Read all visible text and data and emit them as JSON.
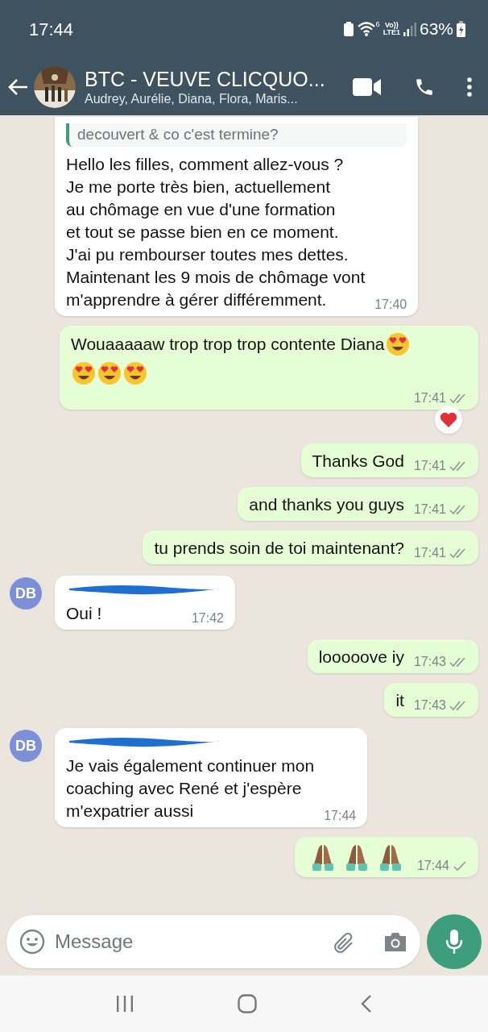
{
  "status_bar": {
    "time": "17:44",
    "network_label_top": "Vo))",
    "network_label_bottom": "LTE1",
    "wifi_superscript": "6",
    "battery": "63%"
  },
  "header": {
    "title": "BTC - VEUVE CLICQUO...",
    "subtitle": "Audrey, Aurélie, Diana, Flora, Maris..."
  },
  "messages": [
    {
      "kind": "incoming",
      "quote": "decouvert & co c'est termine?",
      "parts": [
        {
          "kind": "text",
          "text": "Hello les filles, comment allez-vous ?\nJe me porte très bien, actuellement\nau chômage en vue d'une formation\net tout se passe bien en ce moment.\nJ'ai pu rembourser toutes mes dettes.\nMaintenant les 9 mois de chômage vont\nm'apprendre à gérer différemment."
        }
      ],
      "time": "17:40"
    },
    {
      "kind": "outgoing",
      "parts": [
        {
          "kind": "text",
          "text": "Wouaaaaaw trop trop trop contente Diana"
        },
        {
          "kind": "heart_eyes"
        },
        {
          "kind": "break"
        },
        {
          "kind": "heart_eyes"
        },
        {
          "kind": "heart_eyes"
        },
        {
          "kind": "heart_eyes"
        }
      ],
      "time": "17:41",
      "double_tick": true,
      "heart_reaction": true
    },
    {
      "kind": "outgoing",
      "parts": [
        {
          "kind": "text",
          "text": "Thanks God"
        }
      ],
      "time": "17:41",
      "double_tick": true
    },
    {
      "kind": "outgoing",
      "parts": [
        {
          "kind": "text",
          "text": "and thanks you guys"
        }
      ],
      "time": "17:41",
      "double_tick": true
    },
    {
      "kind": "outgoing",
      "parts": [
        {
          "kind": "text",
          "text": "tu prends soin de toi maintenant?"
        }
      ],
      "time": "17:41",
      "double_tick": true
    },
    {
      "kind": "incoming",
      "avatar": "DB",
      "redacted_name": true,
      "parts": [
        {
          "kind": "text",
          "text": "Oui !"
        }
      ],
      "time": "17:42"
    },
    {
      "kind": "outgoing",
      "parts": [
        {
          "kind": "text",
          "text": "looooove iy"
        }
      ],
      "time": "17:43",
      "double_tick": true
    },
    {
      "kind": "outgoing",
      "parts": [
        {
          "kind": "text",
          "text": "it"
        }
      ],
      "time": "17:43",
      "double_tick": true
    },
    {
      "kind": "incoming",
      "avatar": "DB",
      "redacted_name": true,
      "parts": [
        {
          "kind": "text",
          "text": "Je vais également continuer mon\ncoaching avec René et j'espère\nm'expatrier aussi"
        }
      ],
      "time": "17:44"
    },
    {
      "kind": "outgoing",
      "parts": [
        {
          "kind": "pray"
        },
        {
          "kind": "pray"
        },
        {
          "kind": "pray"
        }
      ],
      "time": "17:44",
      "double_tick": false
    }
  ],
  "composer": {
    "placeholder": "Message"
  }
}
